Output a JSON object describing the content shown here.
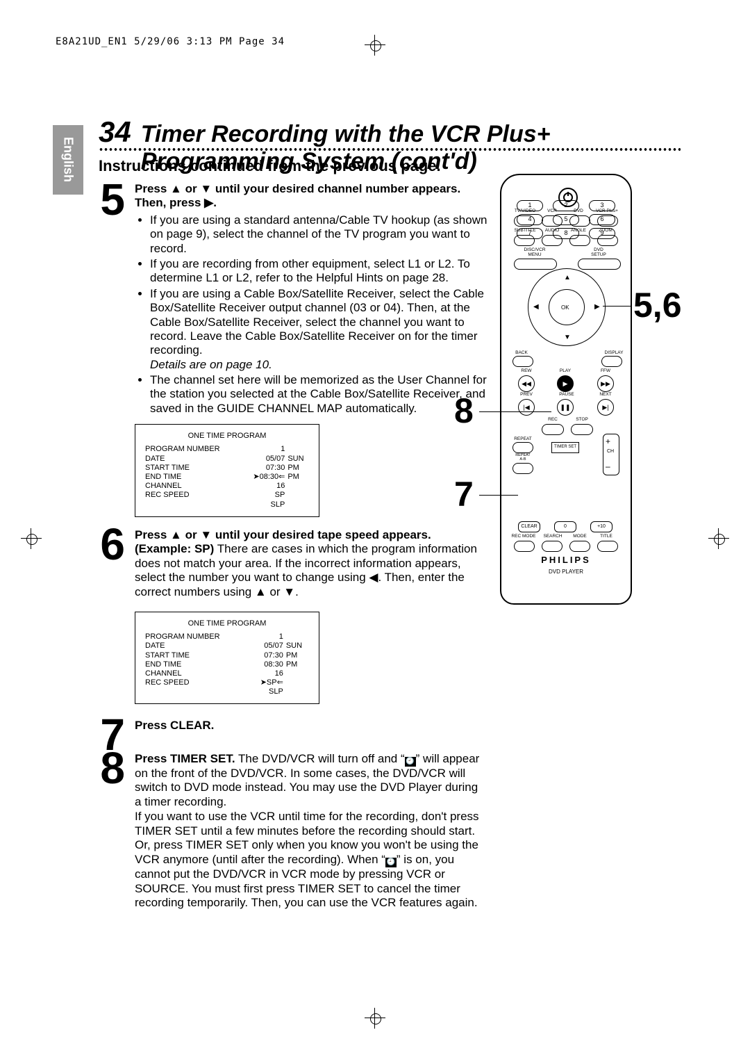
{
  "header_line": "E8A21UD_EN1  5/29/06  3:13 PM  Page 34",
  "tab": "English",
  "page_number": "34",
  "title": "Timer Recording with the VCR Plus+ Programming System (cont'd)",
  "subtitle": "Instructions continued from the previous page.",
  "step5": {
    "num": "5",
    "heading_a": "Press ",
    "heading_b": " or ",
    "heading_c": " until your desired channel number appears.  Then, press ",
    "heading_end": ".",
    "b1": "If you are using a standard antenna/Cable TV hookup (as shown on page 9), select the channel of the TV program you want to record.",
    "b2": "If you are recording from other equipment, select L1 or L2. To determine L1 or L2, refer to the Helpful Hints on page 28.",
    "b3": "If you are using a Cable Box/Satellite Receiver, select the Cable Box/Satellite Receiver output channel (03 or 04). Then, at the Cable Box/Satellite Receiver, select the channel you want to record. Leave the Cable Box/Satellite Receiver on for the timer recording.",
    "b3_italic": "Details are on page 10.",
    "b4": "The channel set here will be memorized as the User Channel for the station you selected at the Cable Box/Satellite Receiver, and saved in the GUIDE CHANNEL MAP automatically."
  },
  "program_box_title": "ONE TIME PROGRAM",
  "pb1": {
    "prognum_label": "PROGRAM NUMBER",
    "prognum_val": "1",
    "date_label": "DATE",
    "date_val": "05/07",
    "date_day": "SUN",
    "start_label": "START  TIME",
    "start_val": "07:30",
    "start_ampm": "PM",
    "end_label": "END    TIME",
    "end_val": "08:30",
    "end_ampm": "PM",
    "chan_label": "CHANNEL",
    "chan_val": "16",
    "rec_label": "REC SPEED",
    "rec_sp": "SP",
    "rec_slp": "SLP",
    "selector_row": "end"
  },
  "step6": {
    "num": "6",
    "heading_a": "Press ",
    "heading_b": " or ",
    "heading_c": " until your desired tape speed appears.",
    "body": "(Example: SP) There are cases in which the program information does not match your area. If the incorrect information appears, select the number you want to change using ◀. Then, enter the correct numbers using ▲ or ▼.",
    "example_bold": "(Example: SP)"
  },
  "pb2": {
    "prognum_label": "PROGRAM NUMBER",
    "prognum_val": "1",
    "date_label": "DATE",
    "date_val": "05/07",
    "date_day": "SUN",
    "start_label": "START  TIME",
    "start_val": "07:30",
    "start_ampm": "PM",
    "end_label": "END    TIME",
    "end_val": "08:30",
    "end_ampm": "PM",
    "chan_label": "CHANNEL",
    "chan_val": "16",
    "rec_label": "REC SPEED",
    "rec_sp": "SP",
    "rec_slp": "SLP",
    "selector_row": "rec"
  },
  "step7": {
    "num": "7",
    "text": "Press CLEAR."
  },
  "step8": {
    "num": "8",
    "lead": "Press TIMER SET.",
    "body": " The DVD/VCR will turn off and \" 🕘 \" will appear on the front of the DVD/VCR. In some cases, the DVD/VCR will switch to DVD mode instead. You may use the DVD Player during a timer recording.\nIf you want to use the VCR until time for the recording, don't press TIMER SET until a few minutes before the recording should start. Or, press TIMER SET only when you know you won't be using the VCR anymore (until after the recording). When \" 🕘 \" is on, you cannot put the DVD/VCR in VCR mode by pressing VCR or SOURCE. You must first press TIMER SET to cancel the timer recording temporarily. Then, you can use the VCR features again."
  },
  "remote": {
    "row1": [
      "TV/VIDEO",
      "VCR",
      "DVD",
      "VCR Plus+"
    ],
    "row2": [
      "SUBTITLE",
      "AUDIO",
      "ANGLE",
      "ZOOM"
    ],
    "row3_left": "DISC/VCR\nMENU",
    "row3_right": "DVD\nSETUP",
    "ok": "OK",
    "back": "BACK",
    "display": "DISPLAY",
    "transport": [
      "REW",
      "PLAY",
      "FFW",
      "PREV",
      "PAUSE",
      "NEXT"
    ],
    "rec": "REC",
    "stop": "STOP",
    "repeat": "REPEAT",
    "repeat_ab": "REPEAT\nA-B",
    "timerset": "TIMER SET",
    "ch": "CH",
    "clear": "CLEAR",
    "plus10": "+10",
    "bottom": [
      "REC MODE",
      "SEARCH",
      "MODE",
      "TITLE"
    ],
    "brand": "PHILIPS",
    "model": "DVD PLAYER"
  },
  "callouts": {
    "c56": "5,6",
    "c7": "7",
    "c8": "8"
  }
}
